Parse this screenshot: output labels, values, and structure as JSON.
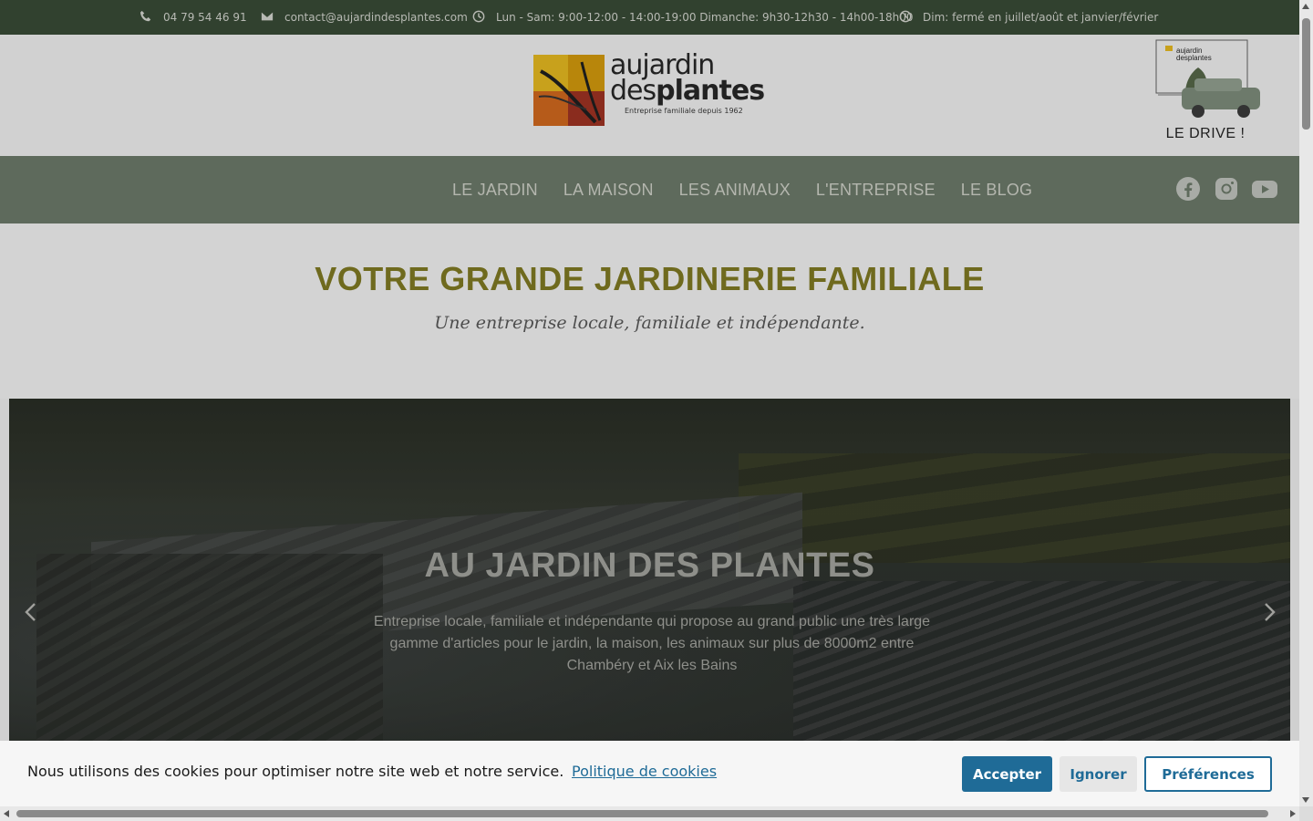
{
  "topbar": {
    "phone": "04 79 54 46 91",
    "email": "contact@aujardindesplantes.com",
    "hours": "Lun - Sam: 9:00-12:00 - 14:00-19:00 Dimanche: 9h30-12h30 - 14h00-18h00",
    "closure": "Dim: fermé en juillet/août et janvier/février"
  },
  "logo": {
    "line1": "aujardin",
    "line2_prefix": "des",
    "line2_bold": "plantes",
    "tagline": "Entreprise familiale depuis 1962"
  },
  "drive": {
    "label": "LE DRIVE !",
    "sign_line1": "aujardin",
    "sign_line2": "desplantes"
  },
  "nav": {
    "items": [
      "LE JARDIN",
      "LA MAISON",
      "LES ANIMAUX",
      "L'ENTREPRISE",
      "LE BLOG"
    ],
    "social": [
      "facebook-icon",
      "instagram-icon",
      "youtube-icon"
    ]
  },
  "intro": {
    "title": "VOTRE GRANDE JARDINERIE FAMILIALE",
    "subtitle": "Une entreprise locale, familiale et indépendante."
  },
  "slider": {
    "title": "AU JARDIN DES PLANTES",
    "text": "Entreprise locale, familiale et indépendante qui propose au grand public une très large gamme d'articles pour le jardin, la maison, les animaux sur plus de 8000m2 entre Chambéry et Aix les Bains"
  },
  "cookie": {
    "message": "Nous utilisons des cookies pour optimiser notre site web et notre service.",
    "policy_link": "Politique de cookies",
    "accept": "Accepter",
    "ignore": "Ignorer",
    "preferences": "Préférences"
  },
  "colors": {
    "topbar_bg": "#31412f",
    "nav_bg": "#5e6a5c",
    "title_olive": "#6f6a1e",
    "cookie_blue": "#1f6b97"
  }
}
